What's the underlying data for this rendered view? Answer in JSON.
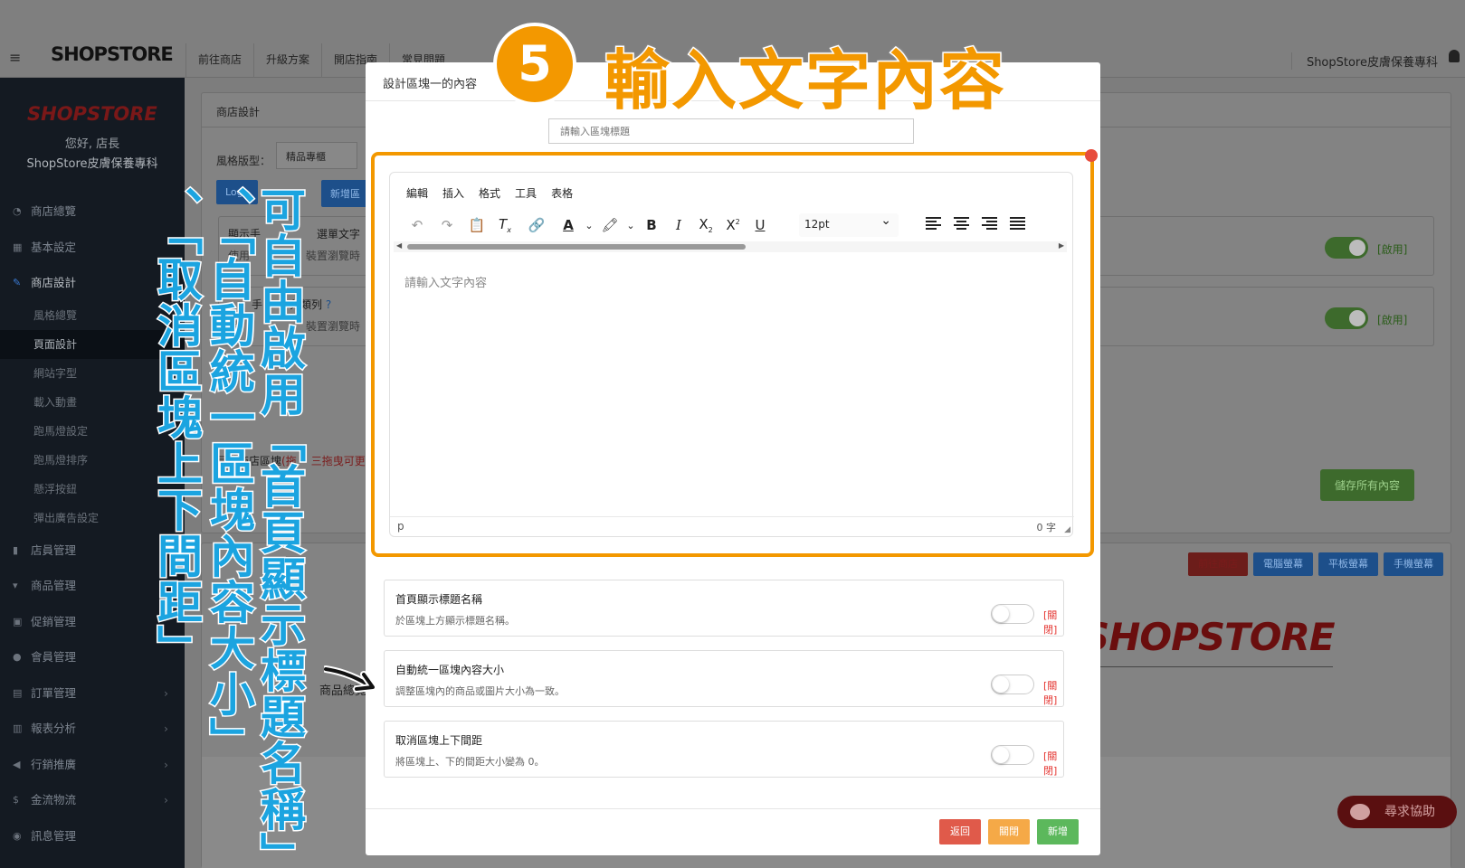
{
  "topbar": {
    "logo": "SHOPSTORE",
    "nav": [
      "前往商店",
      "升級方案",
      "開店指南",
      "常見問題"
    ],
    "shop_name": "ShopStore皮膚保養專科"
  },
  "sidebar": {
    "logo": "SHOPSTORE",
    "greeting": "您好, 店長",
    "shop_name": "ShopStore皮膚保養專科",
    "items_top": [
      {
        "label": "商店總覽",
        "icon": "speedometer-icon"
      },
      {
        "label": "基本設定",
        "icon": "bank-icon"
      },
      {
        "label": "商店設計",
        "icon": "brush-icon"
      }
    ],
    "sub_items": [
      "風格總覽",
      "頁面設計",
      "網站字型",
      "載入動畫",
      "跑馬燈設定",
      "跑馬燈排序",
      "懸浮按鈕",
      "彈出廣告設定"
    ],
    "items_bottom": [
      {
        "label": "店員管理",
        "icon": "lock-icon"
      },
      {
        "label": "商品管理",
        "icon": "cart-icon"
      },
      {
        "label": "促銷管理",
        "icon": "gift-icon"
      },
      {
        "label": "會員管理",
        "icon": "users-icon"
      },
      {
        "label": "訂單管理",
        "icon": "order-icon"
      },
      {
        "label": "報表分析",
        "icon": "chart-icon"
      },
      {
        "label": "行銷推廣",
        "icon": "megaphone-icon"
      },
      {
        "label": "金流物流",
        "icon": "dollar-icon"
      },
      {
        "label": "訊息管理",
        "icon": "chat-icon"
      }
    ]
  },
  "main": {
    "section_title": "商店設計",
    "style_label": "風格版型：",
    "style_value": "精品專櫃",
    "btn_logo": "Logo",
    "btn_add": "新增區",
    "card1_title": "顯示手",
    "card1_title_b": "選單文字",
    "card1_desc": "使用",
    "card1_desc_b": "裝置瀏覽時",
    "card2_title": "手",
    "card2_title_b": "分類列",
    "card2_desc": "平",
    "card2_desc_b": "裝置瀏覽時",
    "enabled": "[啟用]",
    "save_all": "儲存所有內容",
    "current_blocks": "目前商店區塊",
    "current_blocks_b": "(拖",
    "current_blocks_c": "三拖曳可更",
    "preview_buttons": [
      "前往商店",
      "電腦螢幕",
      "平板螢幕",
      "手機螢幕"
    ],
    "big_logo": "SHOPSTORE",
    "product_overview": "商品總覽",
    "help": "尋求協助"
  },
  "modal": {
    "title": "設計區塊一的內容",
    "title_placeholder": "請輸入區塊標題",
    "editor": {
      "menu": [
        "編輯",
        "插入",
        "格式",
        "工具",
        "表格"
      ],
      "font_size": "12pt",
      "placeholder": "請輸入文字內容",
      "path": "p",
      "word_count": "0 字"
    },
    "options": [
      {
        "title": "首頁顯示標題名稱",
        "desc": "於區塊上方顯示標題名稱。",
        "state": "[關閉]"
      },
      {
        "title": "自動統一區塊內容大小",
        "desc": "調整區塊內的商品或圖片大小為一致。",
        "state": "[關閉]"
      },
      {
        "title": "取消區塊上下間距",
        "desc": "將區塊上、下的間距大小變為 0。",
        "state": "[關閉]"
      }
    ],
    "buttons": {
      "back": "返回",
      "close": "關閉",
      "add": "新增"
    }
  },
  "annotations": {
    "step_number": "5",
    "step_title": "輸入文字內容",
    "col1": "可自由啟用「首頁顯示標題名稱」",
    "col2": "、「自動統一區塊內容大小」",
    "col3": "、「取消區塊上下間距」"
  },
  "colors": {
    "accent_orange": "#f39800",
    "annotation_blue": "#1ba4e0",
    "danger": "#e05a4a",
    "warning": "#f5a947",
    "success": "#5cb85c"
  }
}
